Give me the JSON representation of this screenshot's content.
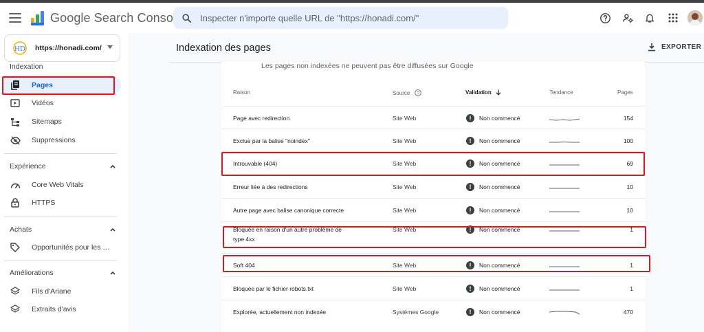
{
  "header": {
    "app_name": "Google Search Console",
    "search_placeholder": "Inspecter n'importe quelle URL de \"https://honadi.com/\""
  },
  "colors": {
    "accent": "#1a73e8",
    "active_bg": "#e8f0fe",
    "highlight": "#e8131a",
    "logo_yellow": "#f9ab00",
    "logo_blue": "#4285f4"
  },
  "sidebar": {
    "property_url": "https://honadi.com/",
    "sections": [
      {
        "title": "Indexation",
        "items": [
          {
            "label": "Pages",
            "icon": "pages-icon",
            "active": true
          },
          {
            "label": "Vidéos",
            "icon": "video-icon"
          },
          {
            "label": "Sitemaps",
            "icon": "sitemap-icon"
          },
          {
            "label": "Suppressions",
            "icon": "eye-off-icon"
          }
        ]
      },
      {
        "title": "Expérience",
        "items": [
          {
            "label": "Core Web Vitals",
            "icon": "gauge-icon"
          },
          {
            "label": "HTTPS",
            "icon": "lock-icon"
          }
        ]
      },
      {
        "title": "Achats",
        "items": [
          {
            "label": "Opportunités pour les m...",
            "icon": "tag-icon"
          }
        ]
      },
      {
        "title": "Améliorations",
        "items": [
          {
            "label": "Fils d'Ariane",
            "icon": "layers-icon"
          },
          {
            "label": "Extraits d'avis",
            "icon": "layers-icon"
          }
        ]
      }
    ]
  },
  "main": {
    "page_title": "Indexation des pages",
    "export_label": "EXPORTER",
    "note": "Les pages non indexées ne peuvent pas être diffusées sur Google",
    "table": {
      "columns": [
        "Raison",
        "Source",
        "Validation",
        "Tendance",
        "Pages"
      ],
      "rows": [
        {
          "reason": "Page avec redirection",
          "source": "Site Web",
          "validation": "Non commencé",
          "pages": "154"
        },
        {
          "reason": "Exclue par la balise \"noindex\"",
          "source": "Site Web",
          "validation": "Non commencé",
          "pages": "100"
        },
        {
          "reason": "Introuvable (404)",
          "source": "Site Web",
          "validation": "Non commencé",
          "pages": "69"
        },
        {
          "reason": "Erreur liée à des redirections",
          "source": "Site Web",
          "validation": "Non commencé",
          "pages": "10"
        },
        {
          "reason": "Autre page avec balise canonique correcte",
          "source": "Site Web",
          "validation": "Non commencé",
          "pages": "10"
        },
        {
          "reason": "Bloquée en raison d'un autre problème de",
          "reason_line2": "type 4xx",
          "source": "Site Web",
          "validation": "Non commencé",
          "pages": "1"
        },
        {
          "reason": "Soft 404",
          "source": "Site Web",
          "validation": "Non commencé",
          "pages": "1"
        },
        {
          "reason": "Bloquée par le fichier robots.txt",
          "source": "Site Web",
          "validation": "Non commencé",
          "pages": "1"
        },
        {
          "reason": "Explorée, actuellement non indexée",
          "source": "Systèmes Google",
          "validation": "Non commencé",
          "pages": "470"
        }
      ]
    }
  }
}
